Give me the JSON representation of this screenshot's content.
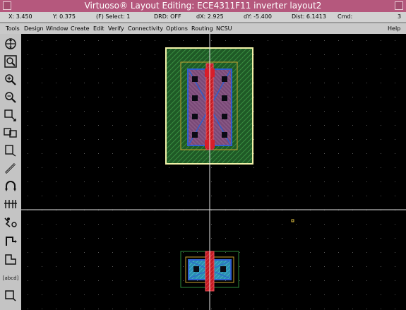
{
  "window": {
    "title": "Virtuoso® Layout Editing: ECE4311F11 inverter layout2"
  },
  "status": {
    "x": "X: 3.450",
    "y": "Y: 0.375",
    "select": "(F) Select: 1",
    "drd": "DRD: OFF",
    "dx": "dX: 2.925",
    "dy": "dY: -5.400",
    "dist": "Dist: 6.1413",
    "cmd": "Cmd:",
    "count": "3"
  },
  "menu": {
    "items": [
      "Tools",
      "Design",
      "Window",
      "Create",
      "Edit",
      "Verify",
      "Connectivity",
      "Options",
      "Routing",
      "NCSU"
    ],
    "help": "Help"
  },
  "toolbar": {
    "tools": [
      "zoom-fit-icon",
      "redraw-icon",
      "zoom-in-icon",
      "zoom-out-icon",
      "stretch-icon",
      "copy-icon",
      "move-icon",
      "path-icon",
      "undo-icon",
      "delete-icon",
      "property-icon",
      "ruler-icon",
      "polygon-icon",
      "label-icon",
      "rectangle-icon"
    ],
    "label_tool_text": "[abcd]"
  },
  "colors": {
    "title_bar": "#b5587d",
    "canvas_bg": "#000000",
    "nwell": "#2e8b3d",
    "poly": "#d81e2a",
    "metal": "#2e5fd0",
    "active": "#c7c86a",
    "selection": "#f2f2a8"
  }
}
